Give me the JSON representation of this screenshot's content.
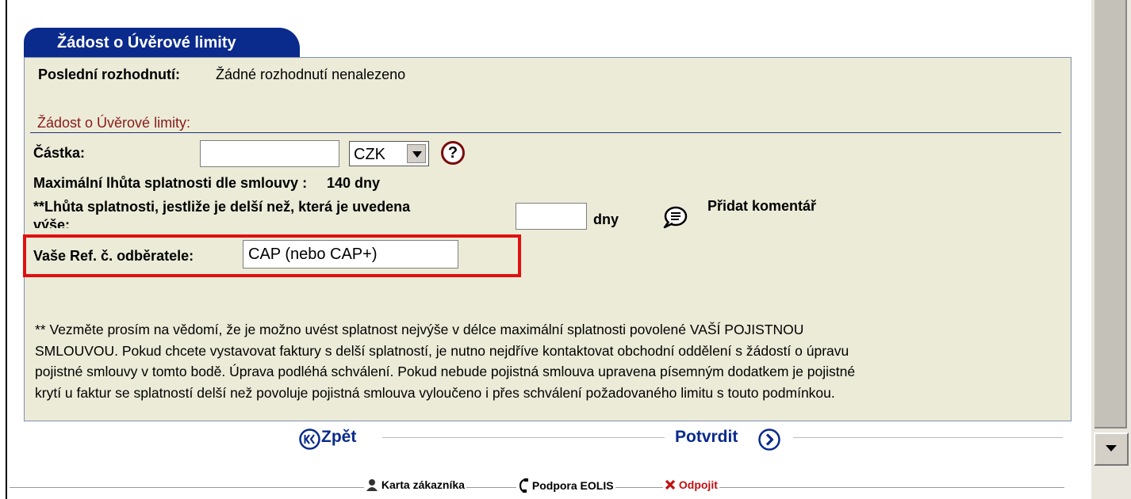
{
  "tab": {
    "title": "Žádost o Úvěrové limity"
  },
  "last_decision": {
    "label": "Poslední rozhodnutí:",
    "value": "Žádné rozhodnutí nenalezeno"
  },
  "section": {
    "title": "Žádost o Úvěrové limity:"
  },
  "amount": {
    "label": "Částka:",
    "value": "",
    "currency": "CZK",
    "help_icon": "question-icon"
  },
  "max_term": {
    "label": "Maximální lhůta splatnosti dle smlouvy :",
    "value": "140 dny"
  },
  "longer_term": {
    "label_line1": "**Lhůta splatnosti, jestliže je delší než, která je uvedena",
    "label_line2": "výše:",
    "value": "",
    "unit": "dny"
  },
  "comment": {
    "label": "Přidat komentář",
    "icon": "comment-bubble-icon"
  },
  "customer_ref": {
    "label": "Vaše Ref. č. odběratele:",
    "value": "CAP (nebo CAP+)"
  },
  "note": {
    "lines": [
      "** Vezměte prosím na vědomí, že je možno uvést splatnost nejvýše v délce maximální splatnosti povolené VAŠÍ POJISTNOU",
      "SMLOUVOU. Pokud chcete vystavovat faktury s delší splatností, je nutno nejdříve kontaktovat obchodní oddělení s žádostí o úpravu",
      "pojistné smlouvy v tomto bodě. Úprava podléhá schválení. Pokud nebude pojistná smlouva upravena písemným dodatkem je pojistné",
      "krytí u faktur se splatností delší než povoluje pojistná smlouva vyloučeno i přes schválení požadovaného limitu s touto podmínkou."
    ]
  },
  "nav": {
    "back": "Zpět",
    "confirm": "Potvrdit"
  },
  "footer": {
    "customer_card": "Karta  zákazníka",
    "support": "Podpora  EOLIS",
    "logout": "Odpojit"
  },
  "colors": {
    "accent": "#0a2a8c",
    "panel": "#ecebd8",
    "highlight": "#e01010",
    "section_title": "#8a1a1a"
  }
}
